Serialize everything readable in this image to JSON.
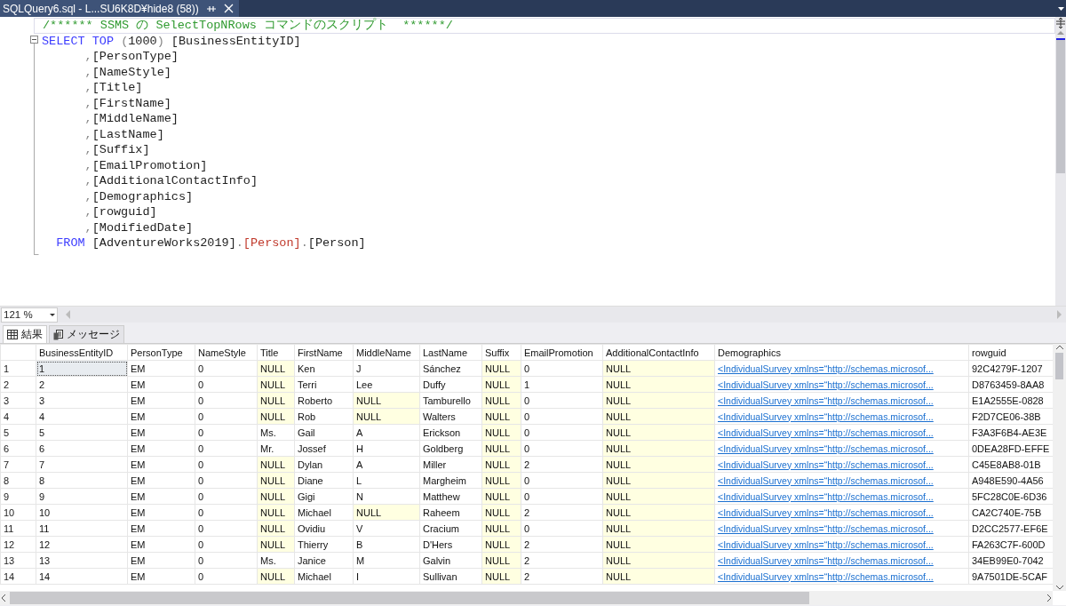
{
  "document_tab": {
    "title": "SQLQuery6.sql - L...SU6K8D¥hide8 (58))",
    "selected": true
  },
  "editor": {
    "lines": [
      [
        {
          "text": "/****** SSMS の SelectTopNRows コマンドのスクリプト  ******/",
          "kind": "comment"
        }
      ],
      [
        {
          "text": "SELECT TOP ",
          "kind": "keyword"
        },
        {
          "text": "(",
          "kind": "operator"
        },
        {
          "text": "1000",
          "kind": "plain"
        },
        {
          "text": ")",
          "kind": "operator"
        },
        {
          "text": " [BusinessEntityID]",
          "kind": "plain"
        }
      ],
      [
        {
          "text": "      ,",
          "kind": "operator"
        },
        {
          "text": "[PersonType]",
          "kind": "plain"
        }
      ],
      [
        {
          "text": "      ,",
          "kind": "operator"
        },
        {
          "text": "[NameStyle]",
          "kind": "plain"
        }
      ],
      [
        {
          "text": "      ,",
          "kind": "operator"
        },
        {
          "text": "[Title]",
          "kind": "plain"
        }
      ],
      [
        {
          "text": "      ,",
          "kind": "operator"
        },
        {
          "text": "[FirstName]",
          "kind": "plain"
        }
      ],
      [
        {
          "text": "      ,",
          "kind": "operator"
        },
        {
          "text": "[MiddleName]",
          "kind": "plain"
        }
      ],
      [
        {
          "text": "      ,",
          "kind": "operator"
        },
        {
          "text": "[LastName]",
          "kind": "plain"
        }
      ],
      [
        {
          "text": "      ,",
          "kind": "operator"
        },
        {
          "text": "[Suffix]",
          "kind": "plain"
        }
      ],
      [
        {
          "text": "      ,",
          "kind": "operator"
        },
        {
          "text": "[EmailPromotion]",
          "kind": "plain"
        }
      ],
      [
        {
          "text": "      ,",
          "kind": "operator"
        },
        {
          "text": "[AdditionalContactInfo]",
          "kind": "plain"
        }
      ],
      [
        {
          "text": "      ,",
          "kind": "operator"
        },
        {
          "text": "[Demographics]",
          "kind": "plain"
        }
      ],
      [
        {
          "text": "      ,",
          "kind": "operator"
        },
        {
          "text": "[rowguid]",
          "kind": "plain"
        }
      ],
      [
        {
          "text": "      ,",
          "kind": "operator"
        },
        {
          "text": "[ModifiedDate]",
          "kind": "plain"
        }
      ],
      [
        {
          "text": "  FROM ",
          "kind": "keyword"
        },
        {
          "text": "[AdventureWorks2019]",
          "kind": "plain"
        },
        {
          "text": ".",
          "kind": "operator"
        },
        {
          "text": "[Person]",
          "kind": "object"
        },
        {
          "text": ".",
          "kind": "operator"
        },
        {
          "text": "[Person]",
          "kind": "plain"
        }
      ]
    ]
  },
  "zoom": {
    "value": "121 %"
  },
  "result_tabs": [
    {
      "label": "結果",
      "selected": true,
      "kind": "grid"
    },
    {
      "label": "メッセージ",
      "selected": false,
      "kind": "messages"
    }
  ],
  "grid": {
    "columns": [
      {
        "label": "BusinessEntityID",
        "kind": "text"
      },
      {
        "label": "PersonType",
        "kind": "text"
      },
      {
        "label": "NameStyle",
        "kind": "text"
      },
      {
        "label": "Title",
        "kind": "text"
      },
      {
        "label": "FirstName",
        "kind": "text"
      },
      {
        "label": "MiddleName",
        "kind": "text"
      },
      {
        "label": "LastName",
        "kind": "text"
      },
      {
        "label": "Suffix",
        "kind": "text"
      },
      {
        "label": "EmailPromotion",
        "kind": "text"
      },
      {
        "label": "AdditionalContactInfo",
        "kind": "text"
      },
      {
        "label": "Demographics",
        "kind": "link"
      },
      {
        "label": "rowguid",
        "kind": "text"
      }
    ],
    "rows": [
      {
        "number": "1",
        "focused": true,
        "cells": [
          "1",
          "EM",
          "0",
          {
            "text": "NULL",
            "null": true
          },
          "Ken",
          "J",
          "Sánchez",
          {
            "text": "NULL",
            "null": true
          },
          "0",
          {
            "text": "NULL",
            "null": true
          },
          "<IndividualSurvey xmlns=“http://schemas.microsof...",
          "92C4279F-1207"
        ]
      },
      {
        "number": "2",
        "focused": false,
        "cells": [
          "2",
          "EM",
          "0",
          {
            "text": "NULL",
            "null": true
          },
          "Terri",
          "Lee",
          "Duffy",
          {
            "text": "NULL",
            "null": true
          },
          "1",
          {
            "text": "NULL",
            "null": true
          },
          "<IndividualSurvey xmlns=“http://schemas.microsof...",
          "D8763459-8AA8"
        ]
      },
      {
        "number": "3",
        "focused": false,
        "cells": [
          "3",
          "EM",
          "0",
          {
            "text": "NULL",
            "null": true
          },
          "Roberto",
          {
            "text": "NULL",
            "null": true
          },
          "Tamburello",
          {
            "text": "NULL",
            "null": true
          },
          "0",
          {
            "text": "NULL",
            "null": true
          },
          "<IndividualSurvey xmlns=“http://schemas.microsof...",
          "E1A2555E-0828"
        ]
      },
      {
        "number": "4",
        "focused": false,
        "cells": [
          "4",
          "EM",
          "0",
          {
            "text": "NULL",
            "null": true
          },
          "Rob",
          {
            "text": "NULL",
            "null": true
          },
          "Walters",
          {
            "text": "NULL",
            "null": true
          },
          "0",
          {
            "text": "NULL",
            "null": true
          },
          "<IndividualSurvey xmlns=“http://schemas.microsof...",
          "F2D7CE06-38B"
        ]
      },
      {
        "number": "5",
        "focused": false,
        "cells": [
          "5",
          "EM",
          "0",
          "Ms.",
          "Gail",
          "A",
          "Erickson",
          {
            "text": "NULL",
            "null": true
          },
          "0",
          {
            "text": "NULL",
            "null": true
          },
          "<IndividualSurvey xmlns=“http://schemas.microsof...",
          "F3A3F6B4-AE3E"
        ]
      },
      {
        "number": "6",
        "focused": false,
        "cells": [
          "6",
          "EM",
          "0",
          "Mr.",
          "Jossef",
          "H",
          "Goldberg",
          {
            "text": "NULL",
            "null": true
          },
          "0",
          {
            "text": "NULL",
            "null": true
          },
          "<IndividualSurvey xmlns=“http://schemas.microsof...",
          "0DEA28FD-EFFE"
        ]
      },
      {
        "number": "7",
        "focused": false,
        "cells": [
          "7",
          "EM",
          "0",
          {
            "text": "NULL",
            "null": true
          },
          "Dylan",
          "A",
          "Miller",
          {
            "text": "NULL",
            "null": true
          },
          "2",
          {
            "text": "NULL",
            "null": true
          },
          "<IndividualSurvey xmlns=“http://schemas.microsof...",
          "C45E8AB8-01B"
        ]
      },
      {
        "number": "8",
        "focused": false,
        "cells": [
          "8",
          "EM",
          "0",
          {
            "text": "NULL",
            "null": true
          },
          "Diane",
          "L",
          "Margheim",
          {
            "text": "NULL",
            "null": true
          },
          "0",
          {
            "text": "NULL",
            "null": true
          },
          "<IndividualSurvey xmlns=“http://schemas.microsof...",
          "A948E590-4A56"
        ]
      },
      {
        "number": "9",
        "focused": false,
        "cells": [
          "9",
          "EM",
          "0",
          {
            "text": "NULL",
            "null": true
          },
          "Gigi",
          "N",
          "Matthew",
          {
            "text": "NULL",
            "null": true
          },
          "0",
          {
            "text": "NULL",
            "null": true
          },
          "<IndividualSurvey xmlns=“http://schemas.microsof...",
          "5FC28C0E-6D36"
        ]
      },
      {
        "number": "10",
        "focused": false,
        "cells": [
          "10",
          "EM",
          "0",
          {
            "text": "NULL",
            "null": true
          },
          "Michael",
          {
            "text": "NULL",
            "null": true
          },
          "Raheem",
          {
            "text": "NULL",
            "null": true
          },
          "2",
          {
            "text": "NULL",
            "null": true
          },
          "<IndividualSurvey xmlns=“http://schemas.microsof...",
          "CA2C740E-75B"
        ]
      },
      {
        "number": "11",
        "focused": false,
        "cells": [
          "11",
          "EM",
          "0",
          {
            "text": "NULL",
            "null": true
          },
          "Ovidiu",
          "V",
          "Cracium",
          {
            "text": "NULL",
            "null": true
          },
          "0",
          {
            "text": "NULL",
            "null": true
          },
          "<IndividualSurvey xmlns=“http://schemas.microsof...",
          "D2CC2577-EF6E"
        ]
      },
      {
        "number": "12",
        "focused": false,
        "cells": [
          "12",
          "EM",
          "0",
          {
            "text": "NULL",
            "null": true
          },
          "Thierry",
          "B",
          "D'Hers",
          {
            "text": "NULL",
            "null": true
          },
          "2",
          {
            "text": "NULL",
            "null": true
          },
          "<IndividualSurvey xmlns=“http://schemas.microsof...",
          "FA263C7F-600D"
        ]
      },
      {
        "number": "13",
        "focused": false,
        "cells": [
          "13",
          "EM",
          "0",
          "Ms.",
          "Janice",
          "M",
          "Galvin",
          {
            "text": "NULL",
            "null": true
          },
          "2",
          {
            "text": "NULL",
            "null": true
          },
          "<IndividualSurvey xmlns=“http://schemas.microsof...",
          "34EB99E0-7042"
        ]
      },
      {
        "number": "14",
        "focused": false,
        "cells": [
          "14",
          "EM",
          "0",
          {
            "text": "NULL",
            "null": true
          },
          "Michael",
          "I",
          "Sullivan",
          {
            "text": "NULL",
            "null": true
          },
          "2",
          {
            "text": "NULL",
            "null": true
          },
          "<IndividualSurvey xmlns=“http://schemas.microsof...",
          "9A7501DE-5CAF"
        ]
      }
    ]
  }
}
